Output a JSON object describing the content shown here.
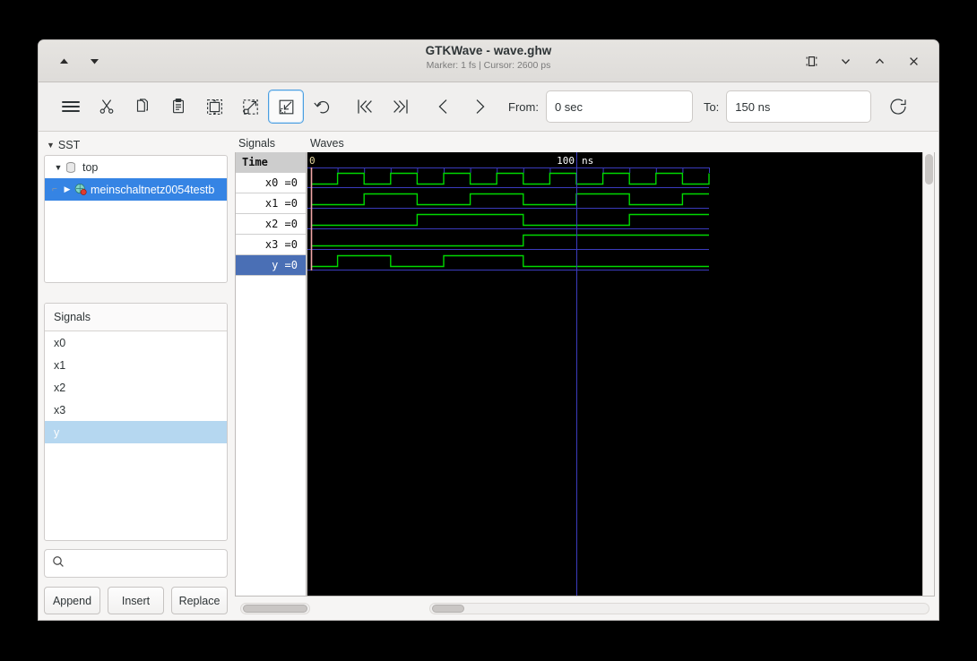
{
  "window": {
    "title": "GTKWave - wave.ghw",
    "subtitle": "Marker: 1 fs  |  Cursor: 2600 ps",
    "nav_up_icon": "triangle-up-icon",
    "nav_down_icon": "triangle-down-icon",
    "restore_icon": "restore-window-icon",
    "minimize_icon": "chevron-down-icon",
    "maximize_icon": "chevron-up-icon",
    "close_icon": "close-icon"
  },
  "toolbar": {
    "items": [
      {
        "name": "menu-button",
        "icon": "hamburger-menu-icon"
      },
      {
        "name": "cut-button",
        "icon": "scissors-icon"
      },
      {
        "name": "copy-button",
        "icon": "copy-icon"
      },
      {
        "name": "paste-button",
        "icon": "clipboard-icon"
      },
      {
        "name": "zoom-fit-button",
        "icon": "zoom-fit-icon"
      },
      {
        "name": "zoom-in-button",
        "icon": "zoom-out-arrow-icon"
      },
      {
        "name": "zoom-out-button",
        "icon": "zoom-in-arrow-icon"
      },
      {
        "name": "undo-button",
        "icon": "undo-arrow-icon"
      },
      {
        "name": "go-start-button",
        "icon": "skip-backward-icon"
      },
      {
        "name": "go-end-button",
        "icon": "skip-forward-icon"
      },
      {
        "name": "prev-edge-button",
        "icon": "chevron-left-icon"
      },
      {
        "name": "next-edge-button",
        "icon": "chevron-right-icon"
      }
    ],
    "active_item": "zoom-out-button",
    "from_label": "From:",
    "from_value": "0 sec",
    "to_label": "To:",
    "to_value": "150 ns",
    "reload_icon": "reload-circular-icon"
  },
  "sidebar": {
    "sst_label": "SST",
    "tree": [
      {
        "label": "top",
        "icon": "cylinder-icon",
        "expanded": true,
        "selected": false,
        "depth": 0
      },
      {
        "label": "meinschaltnetz0054testb",
        "icon": "module-icon",
        "expanded": false,
        "selected": true,
        "depth": 1
      }
    ],
    "signals_header": "Signals",
    "signals": [
      {
        "label": "x0",
        "selected": false
      },
      {
        "label": "x1",
        "selected": false
      },
      {
        "label": "x2",
        "selected": false
      },
      {
        "label": "x3",
        "selected": false
      },
      {
        "label": "y",
        "selected": true
      }
    ],
    "search_placeholder": "",
    "search_value": "",
    "search_icon": "search-icon",
    "buttons": [
      {
        "label": "Append",
        "name": "append-button"
      },
      {
        "label": "Insert",
        "name": "insert-button"
      },
      {
        "label": "Replace",
        "name": "replace-button"
      }
    ]
  },
  "wave_panel": {
    "names_title": "Signals",
    "waves_title": "Waves",
    "time_header": "Time",
    "rows": [
      {
        "label": "x0 =0",
        "selected": false
      },
      {
        "label": "x1 =0",
        "selected": false
      },
      {
        "label": "x2 =0",
        "selected": false
      },
      {
        "label": "x3 =0",
        "selected": false
      },
      {
        "label": "y =0",
        "selected": true
      }
    ],
    "ruler": {
      "start_label": "0",
      "marks": [
        {
          "label": "100 ns",
          "time_ns": 100
        }
      ]
    },
    "colors": {
      "background": "#000000",
      "trace_high": "#00d800",
      "trace_low": "#00d800",
      "gridline": "#3b3bbd",
      "marker": "#f2a6a6",
      "cursor": "#3b3bbd"
    }
  },
  "chart_data": {
    "type": "line",
    "title": "Waves",
    "xlabel": "Time (ns)",
    "xlim": [
      0,
      150
    ],
    "time_unit": "ns",
    "tick_interval_ns": 10,
    "marker_time_ns": 0,
    "cursor_time_ns": 100,
    "data_end_ns": 150,
    "series": [
      {
        "name": "x0",
        "value": 0,
        "period_ns": 20,
        "transitions_ns": [
          0,
          10,
          20,
          30,
          40,
          50,
          60,
          70,
          80,
          90,
          100,
          110,
          120,
          130,
          140,
          150
        ]
      },
      {
        "name": "x1",
        "value": 0,
        "period_ns": 40,
        "transitions_ns": [
          0,
          20,
          40,
          60,
          80,
          100,
          120,
          140
        ]
      },
      {
        "name": "x2",
        "value": 0,
        "period_ns": 80,
        "transitions_ns": [
          0,
          40,
          80,
          120
        ]
      },
      {
        "name": "x3",
        "value": 0,
        "period_ns": 160,
        "transitions_ns": [
          0,
          80
        ]
      },
      {
        "name": "y",
        "value": 0,
        "transitions_ns": [
          0,
          10,
          30,
          50,
          80
        ]
      }
    ]
  }
}
